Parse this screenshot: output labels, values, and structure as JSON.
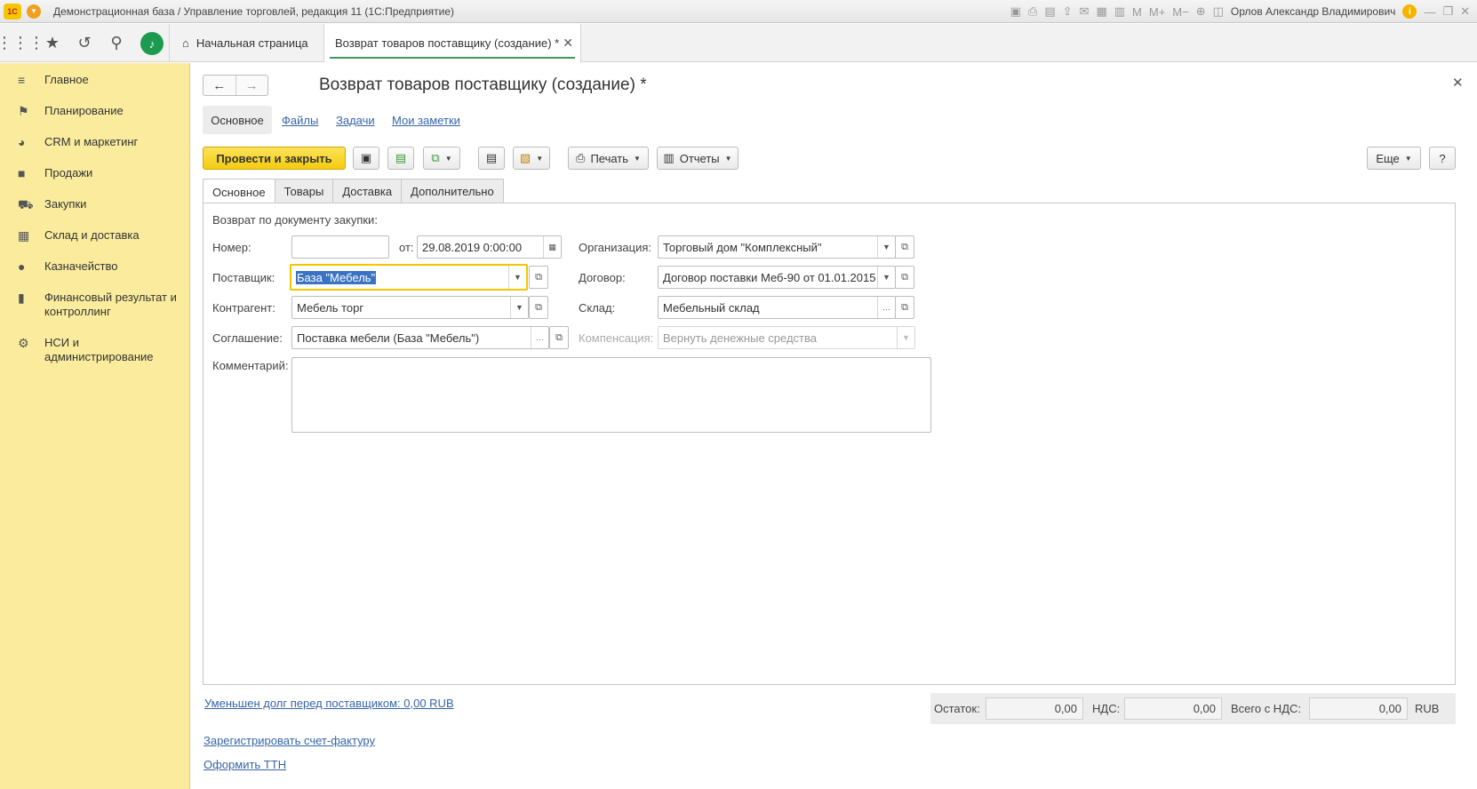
{
  "titlebar": {
    "logo": "1С",
    "title": "Демонстрационная база / Управление торговлей, редакция 11  (1С:Предприятие)",
    "user": "Орлов Александр Владимирович"
  },
  "topbar": {
    "home_tab": "Начальная страница",
    "active_tab": "Возврат товаров поставщику (создание) *"
  },
  "sidebar": {
    "items": [
      {
        "label": "Главное",
        "icon": "menu-icon"
      },
      {
        "label": "Планирование",
        "icon": "planning-icon"
      },
      {
        "label": "CRM и маркетинг",
        "icon": "pie-chart-icon"
      },
      {
        "label": "Продажи",
        "icon": "bag-icon"
      },
      {
        "label": "Закупки",
        "icon": "cart-icon"
      },
      {
        "label": "Склад и доставка",
        "icon": "warehouse-icon"
      },
      {
        "label": "Казначейство",
        "icon": "coin-icon"
      },
      {
        "label": "Финансовый результат и контроллинг",
        "icon": "bar-chart-icon"
      },
      {
        "label": "НСИ и администрирование",
        "icon": "gear-icon"
      }
    ]
  },
  "form": {
    "title": "Возврат товаров поставщику (создание) *",
    "subnav": {
      "main": "Основное",
      "files": "Файлы",
      "tasks": "Задачи",
      "notes": "Мои заметки"
    },
    "commands": {
      "post_close": "Провести и закрыть",
      "print": "Печать",
      "reports": "Отчеты",
      "more": "Еще",
      "help": "?"
    },
    "tabs": [
      "Основное",
      "Товары",
      "Доставка",
      "Дополнительно"
    ],
    "fields": {
      "section_title": "Возврат по документу закупки:",
      "number_label": "Номер:",
      "number_value": "",
      "date_label": "от:",
      "date_value": "29.08.2019  0:00:00",
      "org_label": "Организация:",
      "org_value": "Торговый дом \"Комплексный\"",
      "supplier_label": "Поставщик:",
      "supplier_value": "База \"Мебель\"",
      "contract_label": "Договор:",
      "contract_value": "Договор поставки Меб-90 от 01.01.2015",
      "counterparty_label": "Контрагент:",
      "counterparty_value": "Мебель торг",
      "warehouse_label": "Склад:",
      "warehouse_value": "Мебельный склад",
      "agreement_label": "Соглашение:",
      "agreement_value": "Поставка мебели (База \"Мебель\")",
      "compensation_label": "Компенсация:",
      "compensation_value": "Вернуть денежные средства",
      "comment_label": "Комментарий:",
      "comment_value": ""
    },
    "links": {
      "debt": "Уменьшен долг перед поставщиком: 0,00 RUB",
      "invoice": "Зарегистрировать счет-фактуру",
      "ttn": "Оформить ТТН"
    },
    "totals": {
      "balance_label": "Остаток:",
      "balance_value": "0,00",
      "vat_label": "НДС:",
      "vat_value": "0,00",
      "total_label": "Всего с НДС:",
      "total_value": "0,00",
      "currency": "RUB"
    }
  },
  "colors": {
    "sidebar_bg": "#fbec9d",
    "primary_button": "#f5cc10",
    "link": "#3565a8",
    "accent_green": "#1c9a50"
  }
}
